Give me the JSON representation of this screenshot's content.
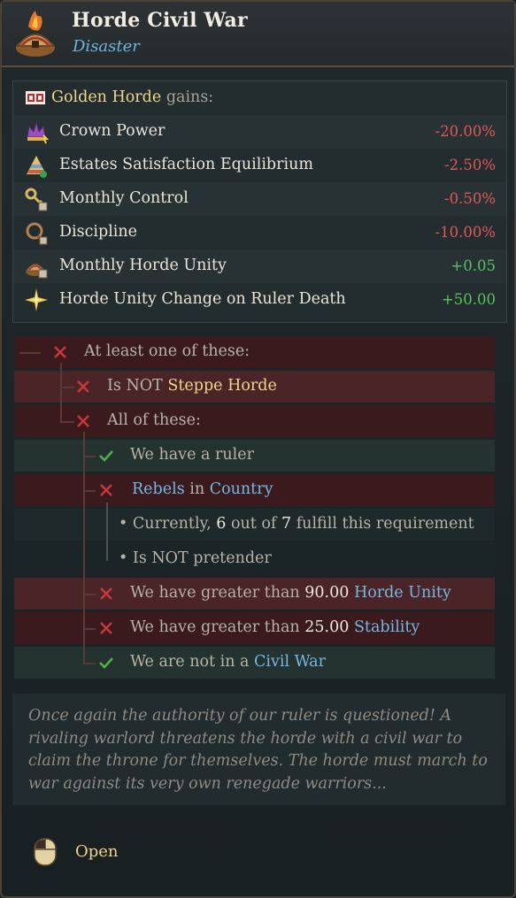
{
  "header": {
    "title": "Horde Civil War",
    "subtitle": "Disaster",
    "icon": "horde-tent-fire-icon"
  },
  "effects": {
    "country": "Golden Horde",
    "gains_label": "gains:",
    "flag_icon": "country-flag-icon",
    "items": [
      {
        "label": "Crown Power",
        "value": "-20.00%",
        "icon": "crown-power-icon",
        "sign": "neg"
      },
      {
        "label": "Estates Satisfaction Equilibrium",
        "value": "-2.50%",
        "icon": "estates-pyramid-icon",
        "sign": "neg"
      },
      {
        "label": "Monthly Control",
        "value": "-0.50%",
        "icon": "control-key-icon",
        "sign": "neg"
      },
      {
        "label": "Discipline",
        "value": "-10.00%",
        "icon": "discipline-whip-icon",
        "sign": "neg"
      },
      {
        "label": "Monthly Horde Unity",
        "value": "+0.05",
        "icon": "horde-unity-icon",
        "sign": "pos"
      },
      {
        "label": "Horde Unity Change on Ruler Death",
        "value": "+50.00",
        "icon": "star-burst-icon",
        "sign": "pos"
      }
    ]
  },
  "requirements": {
    "at_least_one": "At least one of these:",
    "is_not": "Is NOT",
    "steppe_horde": "Steppe Horde",
    "all_of": "All of these:",
    "have_ruler": "We have a ruler",
    "rebels": "Rebels",
    "in": "in",
    "country": "Country",
    "currently_prefix": "Currently,",
    "currently_count": "6",
    "out_of": "out of",
    "currently_total": "7",
    "fulfill": "fulfill this requirement",
    "is_not_pretender": "Is NOT pretender",
    "greater_than": "We have greater than",
    "horde_unity_value": "90.00",
    "horde_unity": "Horde Unity",
    "stability_value": "25.00",
    "stability": "Stability",
    "not_civil_war_prefix": "We are not in a",
    "civil_war": "Civil War"
  },
  "flavor": "Once again the authority of our ruler is questioned! A rivaling warlord threatens the horde with a civil war to claim the throne for themselves. The horde must march to war against its very own renegade warriors...",
  "action": {
    "open_label": "Open",
    "icon": "mouse-left-click-icon"
  },
  "colors": {
    "negative": "#e05858",
    "positive": "#58c45a",
    "highlight_yellow": "#f0d58c",
    "highlight_blue": "#74b8e4",
    "subtitle_blue": "#6fb4e0"
  }
}
